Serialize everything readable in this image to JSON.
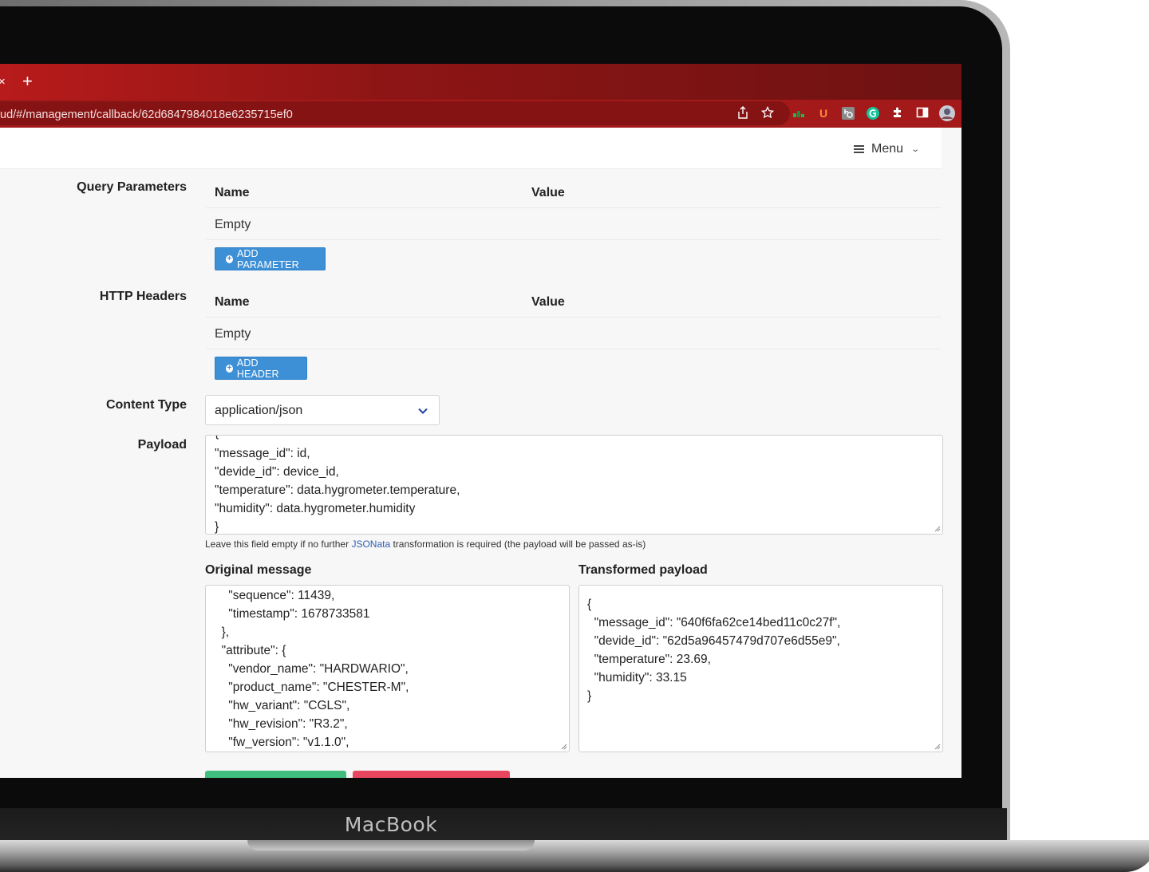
{
  "device": {
    "brand": "MacBook"
  },
  "browser": {
    "tab_close": "×",
    "new_tab": "+",
    "url": "ud/#/management/callback/62d6847984018e6235715ef0",
    "extension_u_label": "U",
    "colors": {
      "tabbar": "#8e1515",
      "toolbar": "#a41919",
      "urlbar": "#861313"
    }
  },
  "appbar": {
    "menu_label": "Menu"
  },
  "query_parameters": {
    "label": "Query Parameters",
    "col_name": "Name",
    "col_value": "Value",
    "empty_text": "Empty",
    "add_button": "ADD PARAMETER"
  },
  "http_headers": {
    "label": "HTTP Headers",
    "col_name": "Name",
    "col_value": "Value",
    "empty_text": "Empty",
    "add_button": "ADD HEADER"
  },
  "content_type": {
    "label": "Content Type",
    "value": "application/json"
  },
  "payload": {
    "label": "Payload",
    "lines": [
      "{",
      "\"message_id\": id,",
      "\"devide_id\": device_id,",
      "\"temperature\": data.hygrometer.temperature,",
      "\"humidity\": data.hygrometer.humidity",
      "}"
    ],
    "help_prefix": "Leave this field empty if no further ",
    "help_link": "JSONata",
    "help_suffix": " transformation is required (the payload will be passed as-is)"
  },
  "original_message": {
    "label": "Original message",
    "lines": [
      "    \"sequence\": 11439,",
      "    \"timestamp\": 1678733581",
      "  },",
      "  \"attribute\": {",
      "    \"vendor_name\": \"HARDWARIO\",",
      "    \"product_name\": \"CHESTER-M\",",
      "    \"hw_variant\": \"CGLS\",",
      "    \"hw_revision\": \"R3.2\",",
      "    \"fw_version\": \"v1.1.0\","
    ]
  },
  "transformed_payload": {
    "label": "Transformed payload",
    "lines": [
      "{",
      "  \"message_id\": \"640f6fa62ce14bed11c0c27f\",",
      "  \"devide_id\": \"62d5a96457479d707e6d55e9\",",
      "  \"temperature\": 23.69,",
      "  \"humidity\": 33.15",
      "}"
    ]
  },
  "colors": {
    "primary_button": "#3d8fd6",
    "save_button": "#3fbe7d",
    "delete_button": "#e8455e"
  }
}
